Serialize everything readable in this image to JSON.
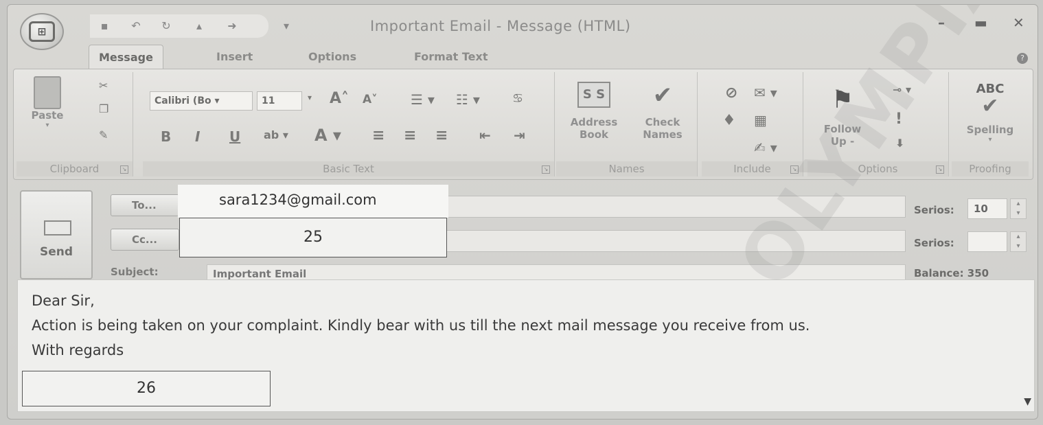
{
  "window": {
    "title": "Important Email - Message (HTML)",
    "controls": [
      "–",
      "▬",
      "✕"
    ]
  },
  "tabs": [
    "Message",
    "Insert",
    "Options",
    "Format Text"
  ],
  "ribbon": {
    "clipboard": {
      "label": "Clipboard",
      "paste": "Paste"
    },
    "basic_text": {
      "label": "Basic Text",
      "font": "Calibri (Bo",
      "size": "11",
      "bold": "B",
      "italic": "I",
      "underline": "U",
      "grow": "A˄",
      "shrink": "A˅"
    },
    "names": {
      "label": "Names",
      "address_book_1": "Address",
      "address_book_2": "Book",
      "check_names_1": "Check",
      "check_names_2": "Names"
    },
    "include": {
      "label": "Include"
    },
    "options": {
      "label": "Options",
      "follow_up_1": "Follow",
      "follow_up_2": "Up -"
    },
    "proofing": {
      "label": "Proofing",
      "spelling": "Spelling",
      "abc": "ABC"
    }
  },
  "header": {
    "send": "Send",
    "to_button": "To...",
    "cc_button": "Cc...",
    "subject_label": "Subject:",
    "subject_value": "Important Email",
    "to_value": "sara1234@gmail.com",
    "cc_value": "25",
    "right": {
      "series_label_1": "Serios:",
      "series_value_1": "10",
      "series_label_2": "Serios:",
      "balance": "Balance: 350"
    }
  },
  "body": {
    "greeting": "Dear Sir,",
    "line1": "Action is being taken on your complaint. Kindly bear with us till the next mail message you receive from us.",
    "closing": "With regards",
    "box_value": "26"
  },
  "watermark": "OLYMPIAD"
}
